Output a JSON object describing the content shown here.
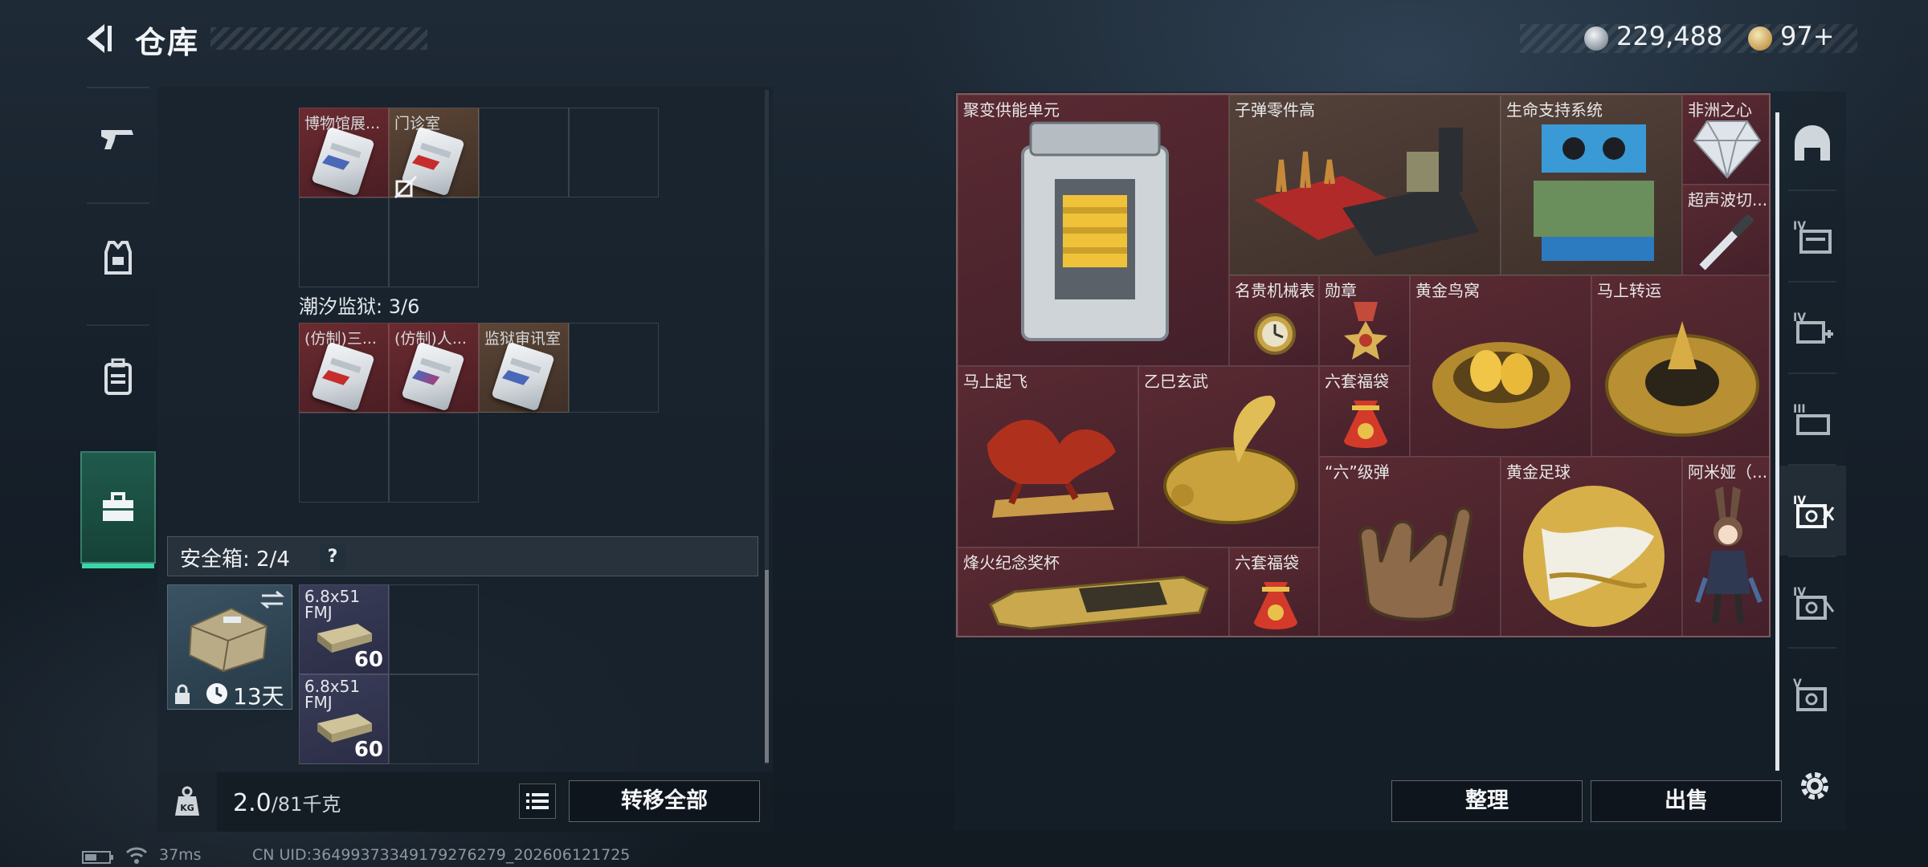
{
  "header": {
    "title": "仓库",
    "money": "229,488",
    "tokens": "97+"
  },
  "left_nav": {
    "items": [
      {
        "name": "weapons",
        "icon": "pistol-icon"
      },
      {
        "name": "armor",
        "icon": "vest-icon"
      },
      {
        "name": "backpack",
        "icon": "backpack-icon"
      },
      {
        "name": "toolbox",
        "icon": "toolbox-icon",
        "active": true
      }
    ]
  },
  "stash": {
    "section1": {
      "items": [
        {
          "label": "博物馆展...",
          "color": "red",
          "mark": "blue"
        },
        {
          "label": "门诊室",
          "color": "brown",
          "mark": "red"
        }
      ]
    },
    "section2": {
      "label": "潮汐监狱: 3/6",
      "items": [
        {
          "label": "(仿制)三...",
          "color": "red",
          "mark": "red"
        },
        {
          "label": "(仿制)人...",
          "color": "red",
          "mark": "mixed"
        },
        {
          "label": "监狱审讯室",
          "color": "brown",
          "mark": "blue"
        }
      ]
    }
  },
  "safe": {
    "label": "安全箱: 2/4",
    "help": "?",
    "days": "13天",
    "ammo": [
      {
        "name": "6.8x51 FMJ",
        "count": "60"
      },
      {
        "name": "6.8x51 FMJ",
        "count": "60"
      }
    ]
  },
  "bottom": {
    "weight": "2.0",
    "weight_max": "/81千克",
    "transfer_all": "转移全部"
  },
  "right_grid": {
    "items": [
      {
        "label": "聚变供能单元",
        "icon": "fusion-unit-icon"
      },
      {
        "label": "子弹零件高",
        "icon": "bullet-parts-icon"
      },
      {
        "label": "生命支持系统",
        "icon": "life-support-icon"
      },
      {
        "label": "非洲之心",
        "icon": "diamond-icon"
      },
      {
        "label": "超声波切...",
        "icon": "ultrasonic-cutter-icon"
      },
      {
        "label": "名贵机械表",
        "icon": "watch-icon"
      },
      {
        "label": "勋章",
        "icon": "medal-icon"
      },
      {
        "label": "黄金鸟窝",
        "icon": "golden-nest-icon"
      },
      {
        "label": "马上转运",
        "icon": "golden-disc-icon"
      },
      {
        "label": "马上起飞",
        "icon": "horse-statue-icon"
      },
      {
        "label": "乙巳玄武",
        "icon": "golden-turtle-icon"
      },
      {
        "label": "六套福袋",
        "icon": "lucky-bag-icon"
      },
      {
        "label": "“六”级弹",
        "icon": "hand-sign-icon"
      },
      {
        "label": "黄金足球",
        "icon": "golden-football-icon"
      },
      {
        "label": "阿米娅（...",
        "icon": "amiya-figure-icon"
      },
      {
        "label": "烽火纪念奖杯",
        "icon": "trophy-icon"
      },
      {
        "label": "六套福袋",
        "icon": "lucky-bag-icon"
      }
    ]
  },
  "right_nav": {
    "items": [
      "dome-icon",
      "container-iv-icon",
      "container-iv-plus-icon",
      "container-iii-icon",
      "container-iv-active-icon",
      "container-iv-b-icon",
      "container-v-icon"
    ]
  },
  "actions": {
    "sort": "整理",
    "sell": "出售"
  },
  "status": {
    "ping": "37ms",
    "uid": "CN UID:3649937334917927­6279_202606121725"
  },
  "colors": {
    "accent": "#39d6a8",
    "red_item": "#5a2a32",
    "brown_item": "#54423a",
    "ammo_item": "#3a3d59"
  }
}
